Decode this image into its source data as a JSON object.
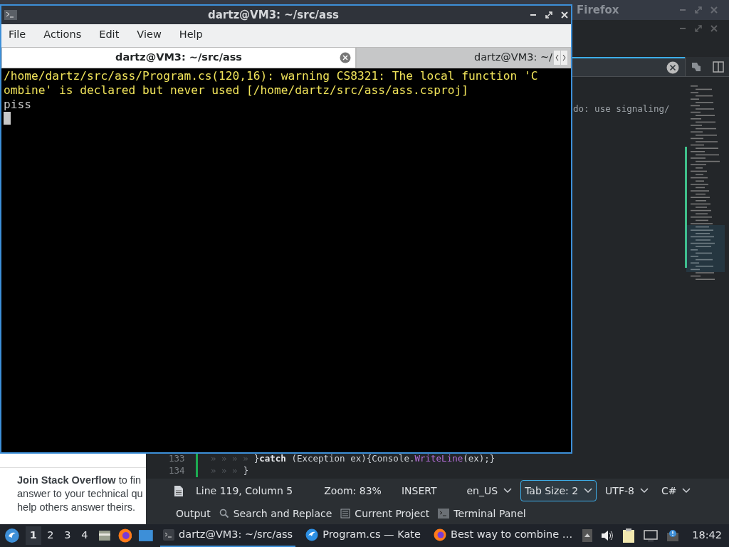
{
  "firefox": {
    "title": "Firefox",
    "page_text": "**Join Stack Overflow** to fin\nanswer to your technical qu\nhelp others answer theirs."
  },
  "kate": {
    "editor_fragment": "do: use signaling/",
    "code_lines": [
      {
        "number": "133",
        "indent": "» » » »",
        "tokens": [
          {
            "text": "}",
            "kind": "plain"
          },
          {
            "text": "catch",
            "kind": "keyword"
          },
          {
            "text": " (Exception ex){Console.",
            "kind": "plain"
          },
          {
            "text": "WriteLine",
            "kind": "method"
          },
          {
            "text": "(ex);}",
            "kind": "plain"
          }
        ]
      },
      {
        "number": "134",
        "indent": "» » »",
        "tokens": [
          {
            "text": "}",
            "kind": "plain"
          }
        ]
      }
    ],
    "status_bar": [
      {
        "kind": "text",
        "label": "Line 119, Column 5"
      },
      {
        "kind": "text",
        "label": "Zoom: 83%"
      },
      {
        "kind": "text",
        "label": "INSERT"
      },
      {
        "kind": "dropdown",
        "label": "en_US",
        "selected": false
      },
      {
        "kind": "dropdown",
        "label": "Tab Size: 2",
        "selected": true
      },
      {
        "kind": "dropdown",
        "label": "UTF-8",
        "selected": false
      },
      {
        "kind": "dropdown",
        "label": "C#",
        "selected": false
      }
    ],
    "panel_buttons": [
      {
        "kind": "plain",
        "label": "Output"
      },
      {
        "kind": "search",
        "label": "Search and Replace"
      },
      {
        "kind": "project",
        "label": "Current Project"
      },
      {
        "kind": "terminal",
        "label": "Terminal Panel"
      }
    ]
  },
  "terminal": {
    "title": "dartz@VM3: ~/src/ass",
    "menu": [
      "File",
      "Actions",
      "Edit",
      "View",
      "Help"
    ],
    "tabs": [
      {
        "label": "dartz@VM3: ~/src/ass",
        "selected": true
      },
      {
        "label": "dartz@VM3: ~/",
        "selected": false
      }
    ],
    "output": [
      {
        "text": "/home/dartz/src/ass/Program.cs(120,16): warning CS8321: The local function 'C",
        "kind": "warning"
      },
      {
        "text": "ombine' is declared but never used [/home/dartz/src/ass/ass.csproj]",
        "kind": "warning"
      },
      {
        "text": "piss",
        "kind": "normal"
      }
    ]
  },
  "taskbar": {
    "workspaces": [
      {
        "label": "1",
        "selected": true
      },
      {
        "label": "2",
        "selected": false
      },
      {
        "label": "3",
        "selected": false
      },
      {
        "label": "4",
        "selected": false
      }
    ],
    "tasks": [
      {
        "kind": "terminal",
        "label": "dartz@VM3: ~/src/ass",
        "selected": true
      },
      {
        "kind": "kate",
        "label": "Program.cs  — Kate",
        "selected": false
      },
      {
        "kind": "firefox",
        "label": "Best way to combine …",
        "selected": false
      }
    ],
    "clock": "18:42"
  }
}
